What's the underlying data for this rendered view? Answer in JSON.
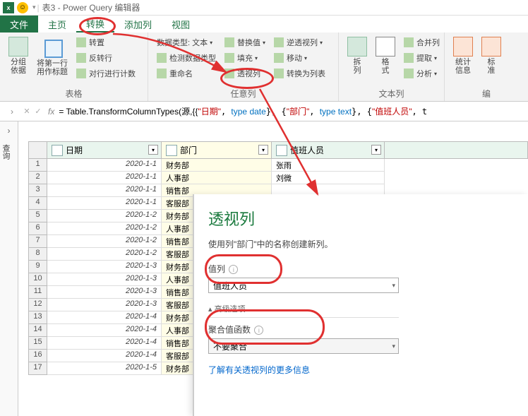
{
  "titlebar": {
    "title": "表3 - Power Query 编辑器"
  },
  "tabs": {
    "file": "文件",
    "home": "主页",
    "transform": "转换",
    "addcol": "添加列",
    "view": "视图"
  },
  "ribbon": {
    "group1": {
      "btn1": "分组\n依据",
      "btn2": "将第一行\n用作标题",
      "s1": "转置",
      "s2": "反转行",
      "s3": "对行进行计数",
      "label": "表格"
    },
    "group2": {
      "s1": "数据类型: 文本",
      "s2": "检测数据类型",
      "s3": "重命名",
      "s4": "替换值",
      "s5": "填充",
      "s6": "透视列",
      "s7": "逆透视列",
      "s8": "移动",
      "s9": "转换为列表",
      "label": "任意列"
    },
    "group3": {
      "btn1": "拆\n列",
      "btn2": "格\n式",
      "s1": "合并列",
      "s2": "提取",
      "s3": "分析",
      "label": "文本列"
    },
    "group4": {
      "btn1": "统计\n信息",
      "btn2": "标\n准",
      "label": "编"
    }
  },
  "formula": {
    "prefix": "= Table.TransformColumnTypes(源,{{",
    "col1": "\"日期\"",
    "t1": "type date",
    "col2": "\"部门\"",
    "t2": "type text",
    "col3": "\"值班人员\""
  },
  "sidebar": {
    "label": "查询"
  },
  "columns": {
    "c1": "日期",
    "c2": "部门",
    "c3": "值班人员"
  },
  "rows": [
    {
      "n": "1",
      "date": "2020-1-1",
      "dept": "财务部",
      "person": "张雨"
    },
    {
      "n": "2",
      "date": "2020-1-1",
      "dept": "人事部",
      "person": "刘微"
    },
    {
      "n": "3",
      "date": "2020-1-1",
      "dept": "销售部",
      "person": ""
    },
    {
      "n": "4",
      "date": "2020-1-1",
      "dept": "客服部",
      "person": ""
    },
    {
      "n": "5",
      "date": "2020-1-2",
      "dept": "财务部",
      "person": ""
    },
    {
      "n": "6",
      "date": "2020-1-2",
      "dept": "人事部",
      "person": ""
    },
    {
      "n": "7",
      "date": "2020-1-2",
      "dept": "销售部",
      "person": ""
    },
    {
      "n": "8",
      "date": "2020-1-2",
      "dept": "客服部",
      "person": ""
    },
    {
      "n": "9",
      "date": "2020-1-3",
      "dept": "财务部",
      "person": ""
    },
    {
      "n": "10",
      "date": "2020-1-3",
      "dept": "人事部",
      "person": ""
    },
    {
      "n": "11",
      "date": "2020-1-3",
      "dept": "销售部",
      "person": ""
    },
    {
      "n": "12",
      "date": "2020-1-3",
      "dept": "客服部",
      "person": ""
    },
    {
      "n": "13",
      "date": "2020-1-4",
      "dept": "财务部",
      "person": ""
    },
    {
      "n": "14",
      "date": "2020-1-4",
      "dept": "人事部",
      "person": ""
    },
    {
      "n": "15",
      "date": "2020-1-4",
      "dept": "销售部",
      "person": ""
    },
    {
      "n": "16",
      "date": "2020-1-4",
      "dept": "客服部",
      "person": ""
    },
    {
      "n": "17",
      "date": "2020-1-5",
      "dept": "财务部",
      "person": ""
    }
  ],
  "dialog": {
    "title": "透视列",
    "desc": "使用列\"部门\"中的名称创建新列。",
    "valLabel": "值列",
    "valSel": "值班人员",
    "adv": "高级选项",
    "aggLabel": "聚合值函数",
    "aggSel": "不要聚合",
    "link": "了解有关透视列的更多信息"
  }
}
